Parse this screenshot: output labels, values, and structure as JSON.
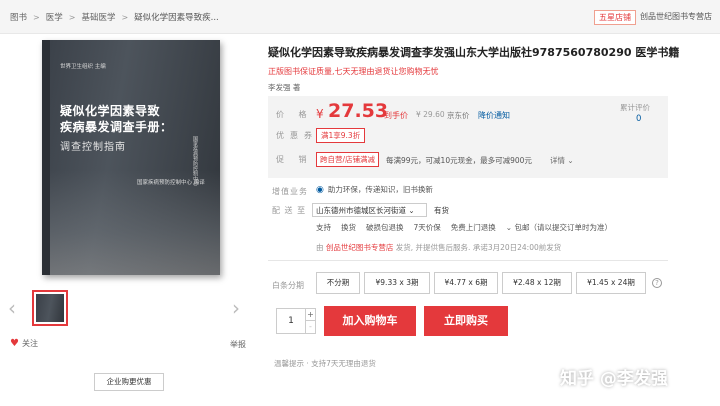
{
  "breadcrumb": {
    "items": [
      "图书",
      "医学",
      "基础医学",
      "疑似化学因素导致疾..."
    ],
    "shop_badge": "五星店铺",
    "shop_name": "创品世纪图书专营店"
  },
  "gallery": {
    "cover": {
      "publisher_line": "世界卫生组织 主编",
      "title_line1": "疑似化学因素导致",
      "title_line2": "疾病暴发调查手册：",
      "subtitle": "调查控制指南",
      "editor_line": "国家疾病预防控制中心 编译",
      "side_text": "国家疾病预防控制中心"
    },
    "follow": "关注",
    "report": "举报",
    "corporate_button": "企业购更优惠"
  },
  "product": {
    "title": "疑似化学因素导致疾病暴发调查李发强山东大学出版社9787560780290 医学书籍",
    "promo": "正版图书保证质量,七天无理由退货让您购物无忧",
    "author": "李发强 著"
  },
  "price": {
    "label": "价 格",
    "currency": "¥",
    "value": "27.53",
    "daoshou": "到手价",
    "original": "¥ 29.60",
    "jd_price": "京东价",
    "notice": "降价通知",
    "review_label": "累计评价",
    "review_count": "0"
  },
  "coupon": {
    "label": "优惠券",
    "text": "满1享9.3折"
  },
  "promotion": {
    "label": "促 销",
    "tag": "跨自营/店铺满减",
    "text": "每满99元，可减10元现金，最多可减900元",
    "detail": "详情"
  },
  "value_added": {
    "label": "增值业务",
    "text": "助力环保，传递知识，旧书换新"
  },
  "delivery": {
    "label": "配 送 至",
    "address": "山东德州市德城区长河街道",
    "stock": "有货",
    "services": [
      "支持",
      "换货",
      "破损包退换",
      "7天价保",
      "免费上门退换",
      "包邮（请以提交订单时为准）"
    ],
    "ship_prefix": "由",
    "ship_shop": "创品世纪图书专营店",
    "ship_suffix": "发货, 并提供售后服务. 承诺3月20日24:00前发货"
  },
  "installment": {
    "label": "白条分期",
    "options": [
      "不分期",
      "¥9.33 x 3期",
      "¥4.77 x 6期",
      "¥2.48 x 12期",
      "¥1.45 x 24期"
    ],
    "help": "?"
  },
  "purchase": {
    "quantity": "1",
    "plus": "+",
    "minus": "-",
    "add_to_cart": "加入购物车",
    "buy_now": "立即购买"
  },
  "tips": "温馨提示 · 支持7天无理由退货",
  "watermark": "知乎 @李发强",
  "colors": {
    "accent": "#e4393c",
    "link": "#005aa0"
  }
}
